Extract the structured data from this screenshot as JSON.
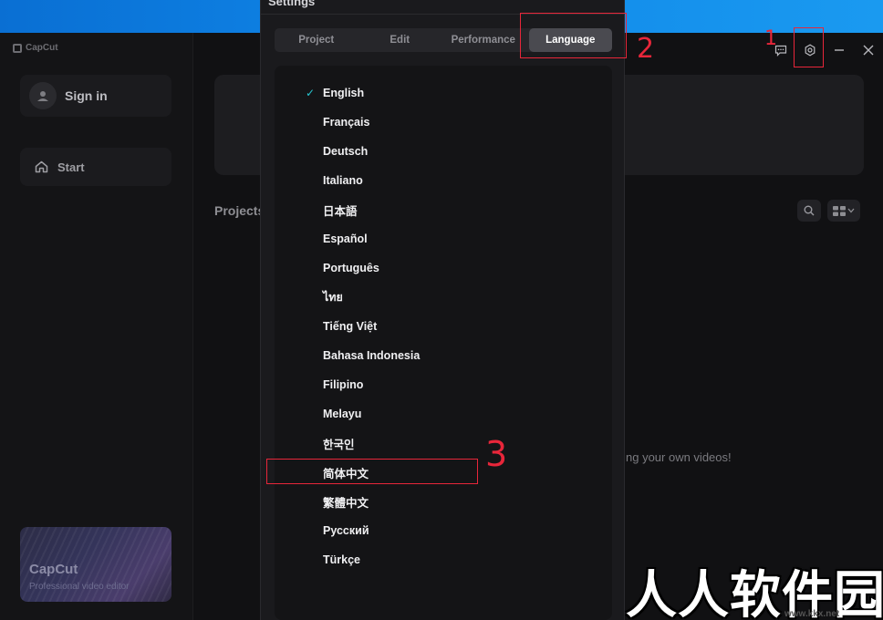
{
  "app": {
    "logo_text": "CapCut",
    "signin_label": "Sign in",
    "start_label": "Start",
    "projects_title": "Projects",
    "empty_text": "ng your own videos!",
    "promo": {
      "title": "CapCut",
      "subtitle": "Professional video editor"
    }
  },
  "settings": {
    "title": "Settings",
    "tabs": [
      {
        "label": "Project"
      },
      {
        "label": "Edit"
      },
      {
        "label": "Performance"
      },
      {
        "label": "Language",
        "active": true
      }
    ],
    "languages": [
      {
        "label": "English",
        "selected": true
      },
      {
        "label": "Français"
      },
      {
        "label": "Deutsch"
      },
      {
        "label": "Italiano"
      },
      {
        "label": "日本語"
      },
      {
        "label": "Español"
      },
      {
        "label": "Português"
      },
      {
        "label": "ไทย"
      },
      {
        "label": "Tiếng Việt"
      },
      {
        "label": "Bahasa Indonesia"
      },
      {
        "label": "Filipino"
      },
      {
        "label": "Melayu"
      },
      {
        "label": "한국인"
      },
      {
        "label": "简体中文"
      },
      {
        "label": "繁體中文"
      },
      {
        "label": "Русский"
      },
      {
        "label": "Türkçe"
      }
    ],
    "check_glyph": "✓"
  },
  "annotations": {
    "step1": "1",
    "step2": "2",
    "step3": "3",
    "color": "#e8263a"
  },
  "watermark": {
    "text": "人人软件园",
    "url": "www.kkx.net"
  },
  "icons": [
    "logo-icon",
    "avatar-icon",
    "home-icon",
    "search-icon",
    "grid-view-icon",
    "chevron-down-icon",
    "feedback-icon",
    "gear-icon",
    "minimize-icon",
    "close-icon",
    "check-icon"
  ]
}
